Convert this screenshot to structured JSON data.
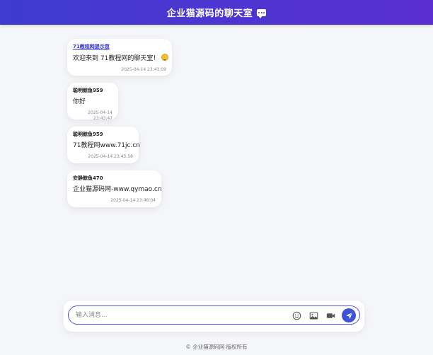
{
  "header": {
    "title": "企业猫源码的聊天室",
    "icon": "chat-bubble-icon"
  },
  "messages": [
    {
      "sender": "71教程网提示您",
      "text": "欢迎来到 71教程网的聊天室！",
      "time": "2025-04-14 23:43:09",
      "emoji": "smile-emoji",
      "sender_link": true
    },
    {
      "sender": "聪明鲸鱼959",
      "text": "你好",
      "time": "2025-04-14 23:43:47"
    },
    {
      "sender": "聪明鲸鱼959",
      "text": "71教程网www.71jc.cn",
      "time": "2025-04-14 23:45:58"
    },
    {
      "sender": "安静鲸鱼470",
      "text": "企业猫源码网-www.qymao.cn",
      "time": "2025-04-14 23:46:04"
    }
  ],
  "composer": {
    "placeholder": "输入消息...",
    "tools": [
      "emoji-icon",
      "image-icon",
      "video-icon"
    ],
    "send_icon": "send-icon"
  },
  "footer": {
    "text": "© 企业猫源码网 版权所有"
  },
  "colors": {
    "header_start": "#3e3bcf",
    "header_end": "#5a2fd0",
    "accent": "#3f51d6",
    "background": "#f5f6fa"
  }
}
